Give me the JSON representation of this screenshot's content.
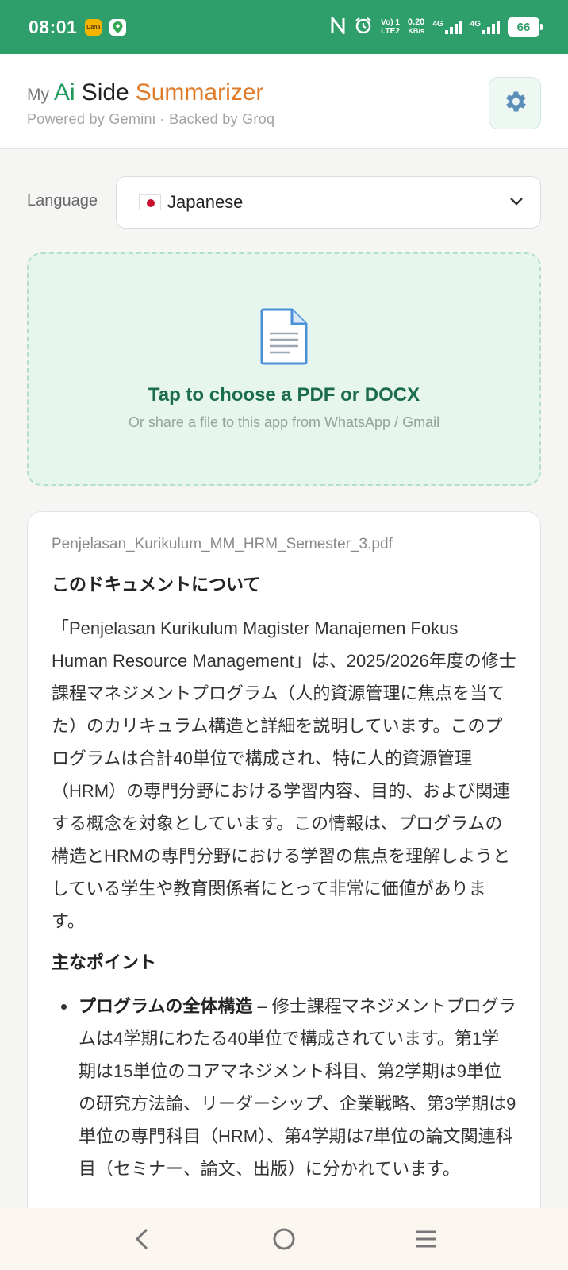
{
  "status_bar": {
    "time": "08:01",
    "dana_icon": "Dana",
    "network_text": "Vo) 1\nLTE2",
    "speed_value": "0.20",
    "speed_unit": "KB/s",
    "net_gen_1": "4G",
    "net_gen_2": "4G",
    "battery": "66"
  },
  "header": {
    "title_my": "My",
    "title_ai": "Ai",
    "title_side": "Side",
    "title_summarizer": "Summarizer",
    "subtitle": "Powered by Gemini · Backed by Groq",
    "settings_icon": "gear-icon"
  },
  "language": {
    "label": "Language",
    "flag": "japan-flag",
    "selected": "Japanese"
  },
  "upload": {
    "title": "Tap to choose a PDF or DOCX",
    "hint": "Or share a file to this app from WhatsApp / Gmail"
  },
  "result": {
    "file_name": "Penjelasan_Kurikulum_MM_HRM_Semester_3.pdf",
    "heading_about": "このドキュメントについて",
    "about_paragraph": "「Penjelasan Kurikulum Magister Manajemen Fokus Human Resource Management」は、2025/2026年度の修士課程マネジメントプログラム（人的資源管理に焦点を当てた）のカリキュラム構造と詳細を説明しています。このプログラムは合計40単位で構成され、特に人的資源管理（HRM）の専門分野における学習内容、目的、および関連する概念を対象としています。この情報は、プログラムの構造とHRMの専門分野における学習の焦点を理解しようとしている学生や教育関係者にとって非常に価値があります。",
    "heading_points": "主なポイント",
    "points": [
      {
        "title": "プログラムの全体構造",
        "text": " – 修士課程マネジメントプログラムは4学期にわたる40単位で構成されています。第1学期は15単位のコアマネジメント科目、第2学期は9単位の研究方法論、リーダーシップ、企業戦略、第3学期は9単位の専門科目（HRM）、第4学期は7単位の論文関連科目（セミナー、論文、出版）に分かれています。"
      }
    ]
  },
  "nav": {
    "back": "back-icon",
    "home": "home-icon",
    "recents": "menu-icon"
  },
  "colors": {
    "status_green": "#2e9e6b",
    "ai_green": "#1f9a5a",
    "summarizer_orange": "#e07b2a",
    "upload_title": "#1b6b4d"
  }
}
